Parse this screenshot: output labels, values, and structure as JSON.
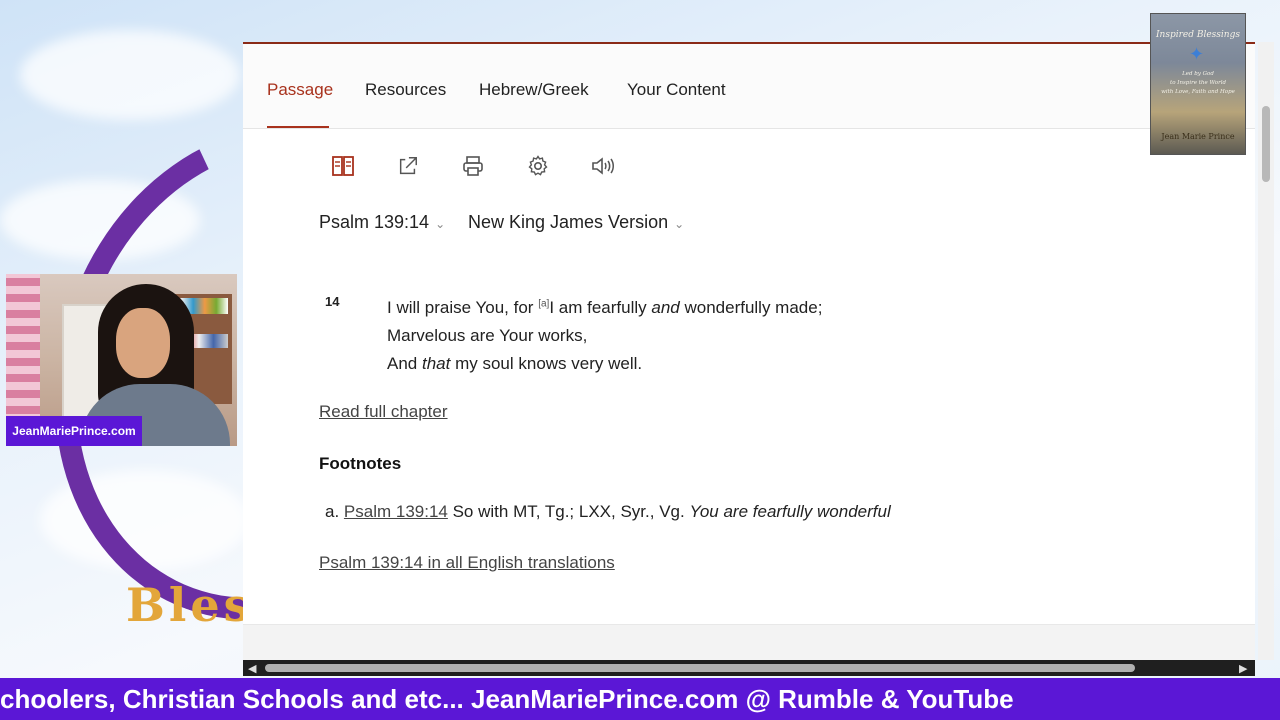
{
  "tabs": [
    {
      "label": "Passage",
      "active": true
    },
    {
      "label": "Resources",
      "active": false
    },
    {
      "label": "Hebrew/Greek",
      "active": false
    },
    {
      "label": "Your Content",
      "active": false
    }
  ],
  "toolbar": {
    "icons": [
      "parallel-view-icon",
      "share-icon",
      "print-icon",
      "settings-icon",
      "audio-icon"
    ]
  },
  "passage": {
    "reference": "Psalm 139:14",
    "version": "New King James Version",
    "verse_number": "14",
    "line1_a": "I will praise You, for ",
    "footnote_marker": "[a]",
    "line1_b": "I am fearfully ",
    "line1_italic": "and",
    "line1_c": " wonderfully made;",
    "line2": "Marvelous are Your works,",
    "line3_a": "And ",
    "line3_italic": "that",
    "line3_b": " my soul knows very well.",
    "read_full_chapter": "Read full chapter"
  },
  "footnotes": {
    "heading": "Footnotes",
    "items": [
      {
        "letter": "a.",
        "ref": "Psalm 139:14",
        "text": " So with MT, Tg.; LXX, Syr., Vg. ",
        "italic": "You are fearfully wonderful"
      }
    ],
    "all_translations_link": "Psalm 139:14 in all English translations"
  },
  "overlay": {
    "webcam_label": "JeanMariePrince.com",
    "ticker": "choolers, Christian Schools and etc... JeanMariePrince.com @ Rumble & YouTube",
    "background_text": "Bless",
    "book": {
      "title": "Inspired Blessings",
      "subtitle_1": "Led by God",
      "subtitle_2": "to Inspire the World",
      "subtitle_3": "with Love, Faith and Hope",
      "author": "Jean Marie Prince"
    }
  },
  "colors": {
    "accent": "#a8321d",
    "ticker_bg": "#5b17d6"
  }
}
